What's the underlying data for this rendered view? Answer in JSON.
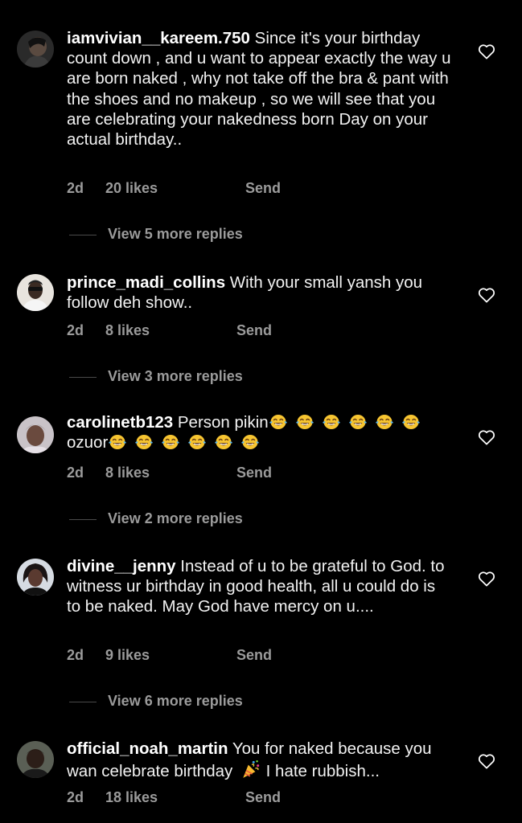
{
  "comments": [
    {
      "username": "iamvivian__kareem.750",
      "text": " Since it's your birthday count down , and u want to appear exactly the way u are born naked , why not take off the bra & pant with the shoes and no makeup , so we will see that you are celebrating your nakedness born Day on your actual birthday..",
      "time": "2d",
      "likes": "20 likes",
      "send": "Send",
      "replies": "View 5 more replies",
      "avatar_icon": "avatar-photo-dark"
    },
    {
      "username": "prince_madi_collins",
      "text": " With your small yansh you follow deh show..",
      "time": "2d",
      "likes": "8 likes",
      "send": "Send",
      "replies": "View 3 more replies",
      "avatar_icon": "avatar-photo-man-sunglasses"
    },
    {
      "username": "carolinetb123",
      "text": " Person pikin",
      "text_line2": "ozuor",
      "emoji_icon": "face-with-tears-of-joy",
      "emoji_count_line1": 6,
      "emoji_count_line2": 6,
      "time": "2d",
      "likes": "8 likes",
      "send": "Send",
      "replies": "View 2 more replies",
      "avatar_icon": "avatar-photo-woman"
    },
    {
      "username": "divine__jenny",
      "text": " Instead of u to be grateful to God. to witness ur birthday in good health, all u could do is to be naked. May God have mercy on u....",
      "time": "2d",
      "likes": "9 likes",
      "send": "Send",
      "replies": "View 6 more replies",
      "avatar_icon": "avatar-photo-woman-2"
    },
    {
      "username": "official_noah_martin",
      "text": " You for naked because you wan celebrate birthday",
      "text_after_emoji": " I hate rubbish...",
      "emoji_icon": "party-popper",
      "time": "2d",
      "likes": "18 likes",
      "send": "Send",
      "avatar_icon": "avatar-photo-boy"
    }
  ],
  "colors": {
    "background": "#000000",
    "text": "#f2f2f2",
    "meta": "#9b9b9b",
    "heart_outline": "#ffffff"
  },
  "icons": {
    "like": "heart-outline-icon"
  }
}
